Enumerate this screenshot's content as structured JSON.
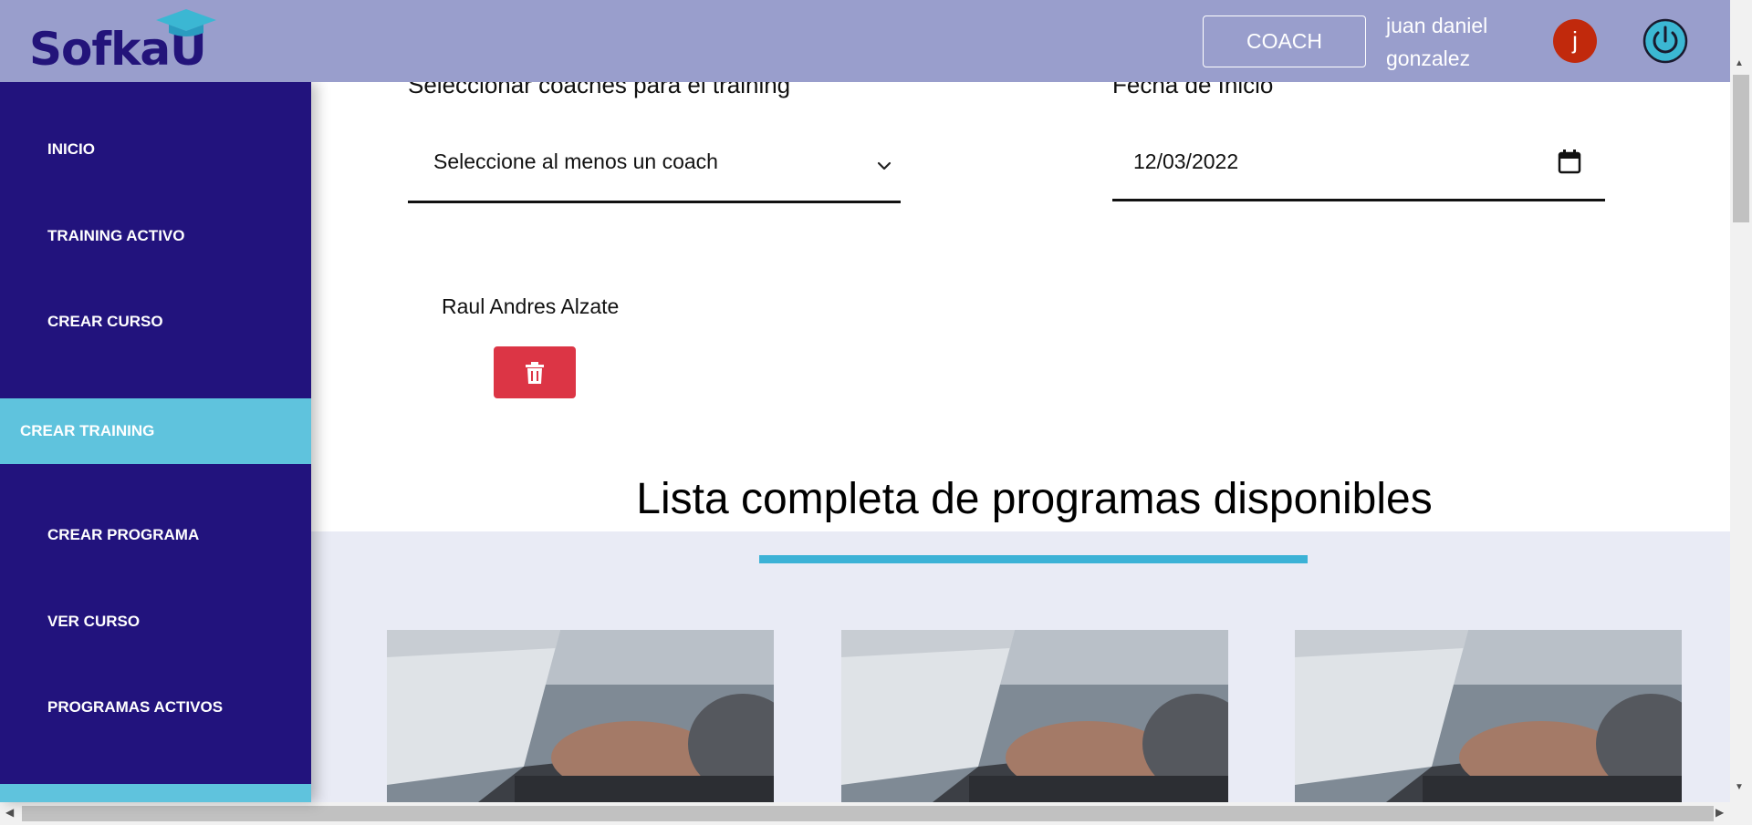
{
  "header": {
    "logo_text": "SofkaU",
    "role_label": "COACH",
    "user_name": "juan daniel gonzalez",
    "avatar_initial": "j",
    "colors": {
      "header_bg": "#999ecc",
      "logo": "#23147a",
      "avatar": "#c1290c",
      "power": "#3bb7d3"
    }
  },
  "sidebar": {
    "items": [
      {
        "label": "INICIO",
        "active": false
      },
      {
        "label": "TRAINING ACTIVO",
        "active": false
      },
      {
        "label": "CREAR CURSO",
        "active": false
      },
      {
        "label": "CREAR TRAINING",
        "active": true
      },
      {
        "label": "CREAR PROGRAMA",
        "active": false
      },
      {
        "label": "VER CURSO",
        "active": false
      },
      {
        "label": "PROGRAMAS ACTIVOS",
        "active": false
      }
    ],
    "colors": {
      "bg": "#22137d",
      "active_bg": "#5fc3dd"
    }
  },
  "form": {
    "coaches_label": "Seleccionar coaches para el training",
    "coaches_select_value": "Seleccione al menos un coach",
    "date_label": "Fecha de Inicio",
    "date_value": "12/03/2022",
    "selected_coaches": [
      {
        "name": "Raul Andres Alzate"
      }
    ],
    "delete_icon": "trash-icon",
    "delete_color": "#dc3545"
  },
  "programs": {
    "title": "Lista completa de programas disponibles",
    "accent_color": "#3cb2d6",
    "cards": [
      {
        "image": "laptop-typing-photo"
      },
      {
        "image": "laptop-typing-photo"
      },
      {
        "image": "laptop-typing-photo"
      }
    ]
  }
}
